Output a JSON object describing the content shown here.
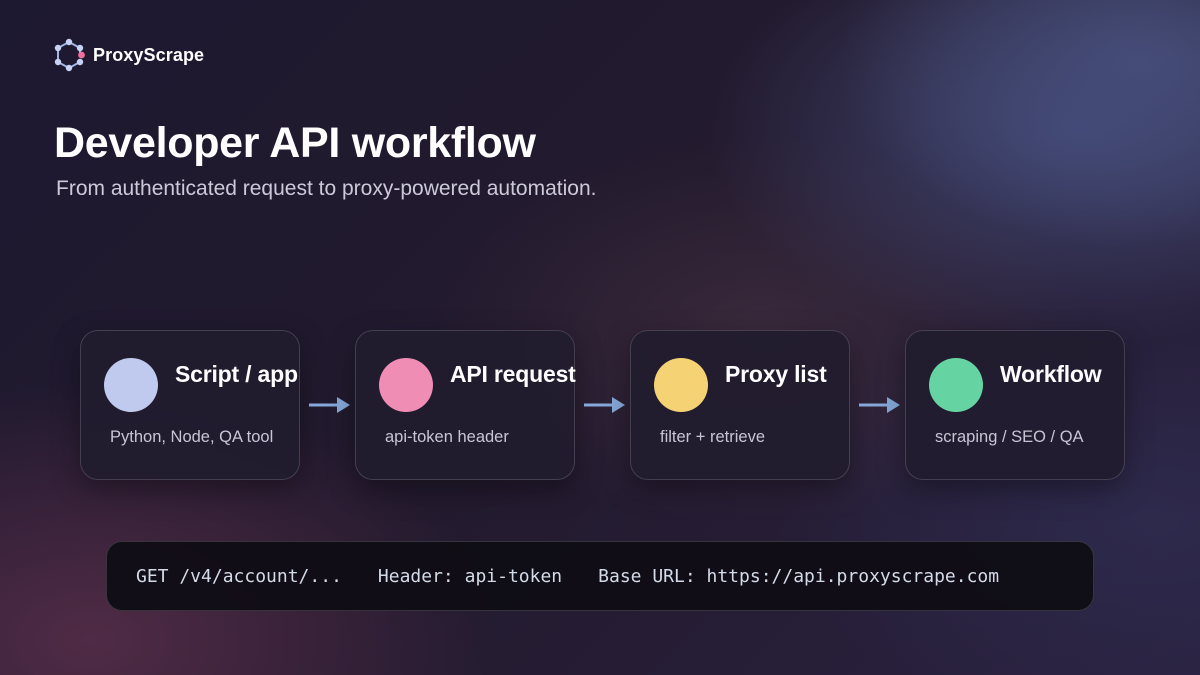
{
  "brand": {
    "name": "ProxyScrape",
    "logo_icon": "network-nodes-icon"
  },
  "header": {
    "title": "Developer API workflow",
    "subtitle": "From authenticated request to proxy-powered automation."
  },
  "flow": {
    "steps": [
      {
        "title": "Script / app",
        "description": "Python, Node, QA tool",
        "dot_color": "#c0c9ee"
      },
      {
        "title": "API request",
        "description": "api-token header",
        "dot_color": "#ef8db5"
      },
      {
        "title": "Proxy list",
        "description": "filter + retrieve",
        "dot_color": "#f5d273"
      },
      {
        "title": "Workflow",
        "description": "scraping / SEO / QA",
        "dot_color": "#66d4a2"
      }
    ],
    "arrow_color": "#86a9da",
    "arrow_icon": "arrow-right-icon"
  },
  "code_bar": {
    "endpoint": "GET /v4/account/...",
    "header": "Header: api-token",
    "base_url": "Base URL: https://api.proxyscrape.com"
  }
}
